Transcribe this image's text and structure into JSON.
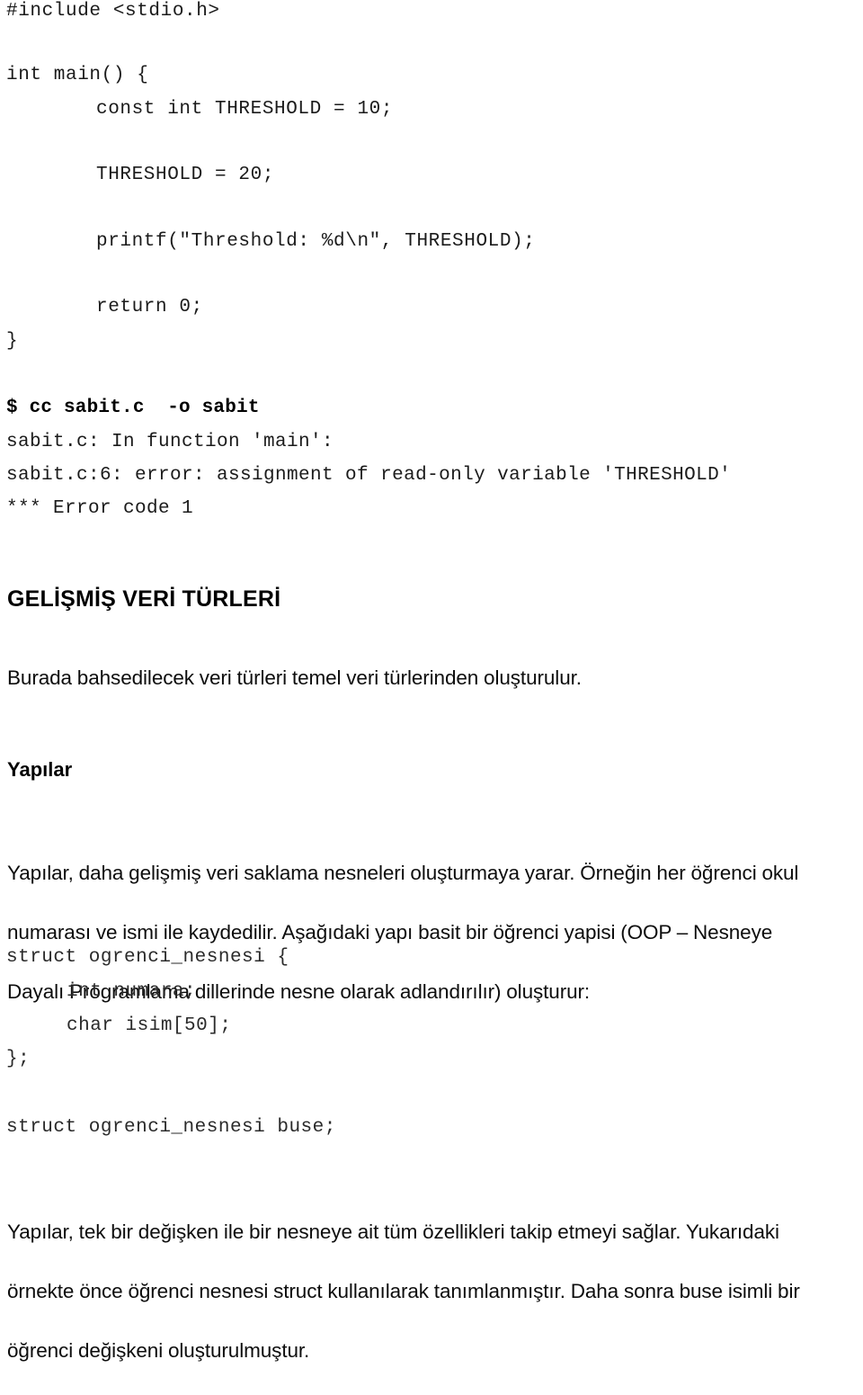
{
  "document": {
    "type": "scanned-lecture-notes",
    "language": "tr",
    "background_color": "#ffffff",
    "text_color": "#000000"
  },
  "code_block_program": {
    "name": "c-program-const-threshold",
    "lines": [
      "#include <stdio.h>",
      "int main() {",
      "const int THRESHOLD = 10;",
      "THRESHOLD = 20;",
      "printf(\"Threshold: %d\\n\", THRESHOLD);",
      "return 0;",
      "}"
    ]
  },
  "terminal_block": {
    "name": "compiler-error-output",
    "command": "$ cc sabit.c  -o sabit",
    "output_lines": [
      "sabit.c: In function 'main':",
      "sabit.c:6: error: assignment of read-only variable 'THRESHOLD'",
      "*** Error code 1"
    ]
  },
  "section_heading": "GELİŞMİŞ VERİ TÜRLERİ",
  "section_intro": "Burada bahsedilecek veri türleri temel veri türlerinden oluşturulur.",
  "subsection_heading": "Yapılar",
  "paragraph_structs": {
    "lines": [
      "Yapılar, daha gelişmiş veri saklama nesneleri oluşturmaya yarar. Örneğin her öğrenci okul",
      "numarası ve ismi ile kaydedilir. Aşağıdaki yapı basit bir öğrenci yapisi (OOP – Nesneye",
      "Dayalı Programlama dillerinde nesne olarak adlandırılır) oluşturur:"
    ]
  },
  "code_block_struct": {
    "name": "struct-ogrenci-nesnesi",
    "lines": [
      "struct ogrenci_nesnesi {",
      "int numara;",
      "char isim[50];",
      "};"
    ]
  },
  "code_block_declaration": {
    "name": "struct-variable-declaration",
    "line": "struct ogrenci_nesnesi buse;"
  },
  "paragraph_closing": {
    "lines": [
      "Yapılar, tek bir değişken ile bir nesneye ait tüm özellikleri takip etmeyi sağlar. Yukarıdaki",
      "örnekte önce öğrenci nesnesi struct kullanılarak tanımlanmıştır. Daha sonra buse isimli bir",
      "öğrenci değişkeni oluşturulmuştur."
    ]
  }
}
